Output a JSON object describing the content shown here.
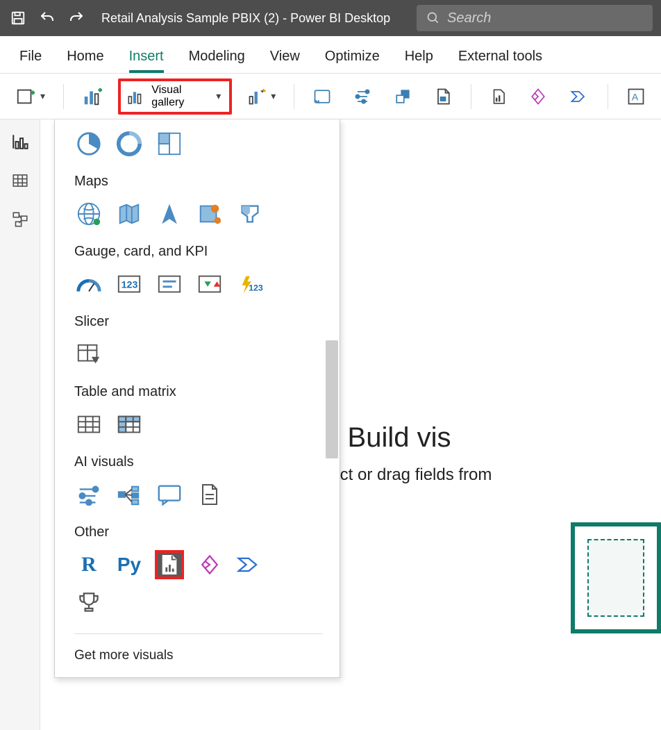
{
  "title_bar": {
    "title": "Retail Analysis Sample PBIX (2) - Power BI Desktop",
    "search_placeholder": "Search"
  },
  "menu": {
    "items": [
      "File",
      "Home",
      "Insert",
      "Modeling",
      "View",
      "Optimize",
      "Help",
      "External tools"
    ],
    "active": "Insert"
  },
  "toolbar": {
    "visual_gallery_label": "Visual gallery"
  },
  "gallery": {
    "section_maps": "Maps",
    "section_gauge": "Gauge, card, and KPI",
    "section_slicer": "Slicer",
    "section_table": "Table and matrix",
    "section_ai": "AI visuals",
    "section_other": "Other",
    "get_more": "Get more visuals",
    "r_label": "R",
    "py_label": "Py"
  },
  "canvas": {
    "title_partial": "Build vis",
    "subtitle_partial": "Select or drag fields from"
  }
}
